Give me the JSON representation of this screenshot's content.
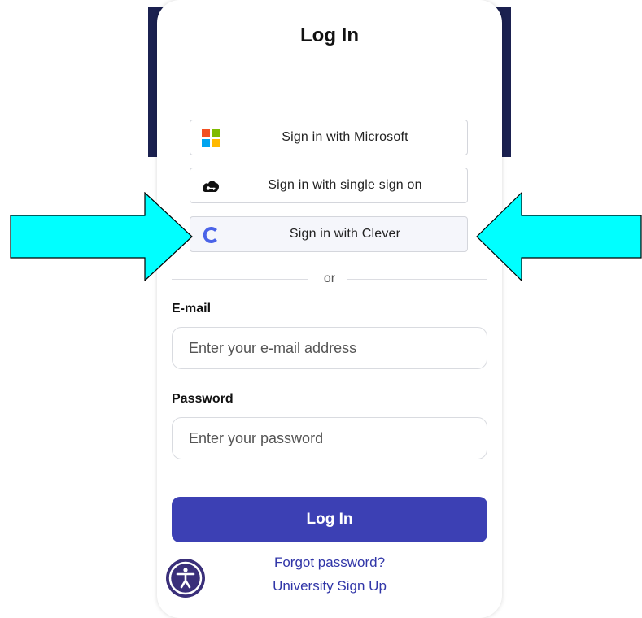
{
  "login": {
    "title": "Log In",
    "sso": {
      "microsoft": "Sign in with Microsoft",
      "single_sign_on": "Sign in with single sign on",
      "clever": "Sign in with Clever"
    },
    "divider": "or",
    "email": {
      "label": "E-mail",
      "placeholder": "Enter your e-mail address"
    },
    "password": {
      "label": "Password",
      "placeholder": "Enter your password"
    },
    "submit_label": "Log In",
    "forgot_password": "Forgot password?",
    "university_signup": "University Sign Up"
  },
  "icons": {
    "microsoft": "microsoft-logo-icon",
    "sso": "cloud-key-icon",
    "clever": "clever-logo-icon",
    "accessibility": "accessibility-icon",
    "annotation_arrows": "cyan-arrow-icon"
  },
  "colors": {
    "header_band": "#1b2150",
    "primary_button": "#3c40b4",
    "link": "#3136a8",
    "clever_blue": "#4a63e8",
    "annotation_arrow": "#00ffff"
  }
}
